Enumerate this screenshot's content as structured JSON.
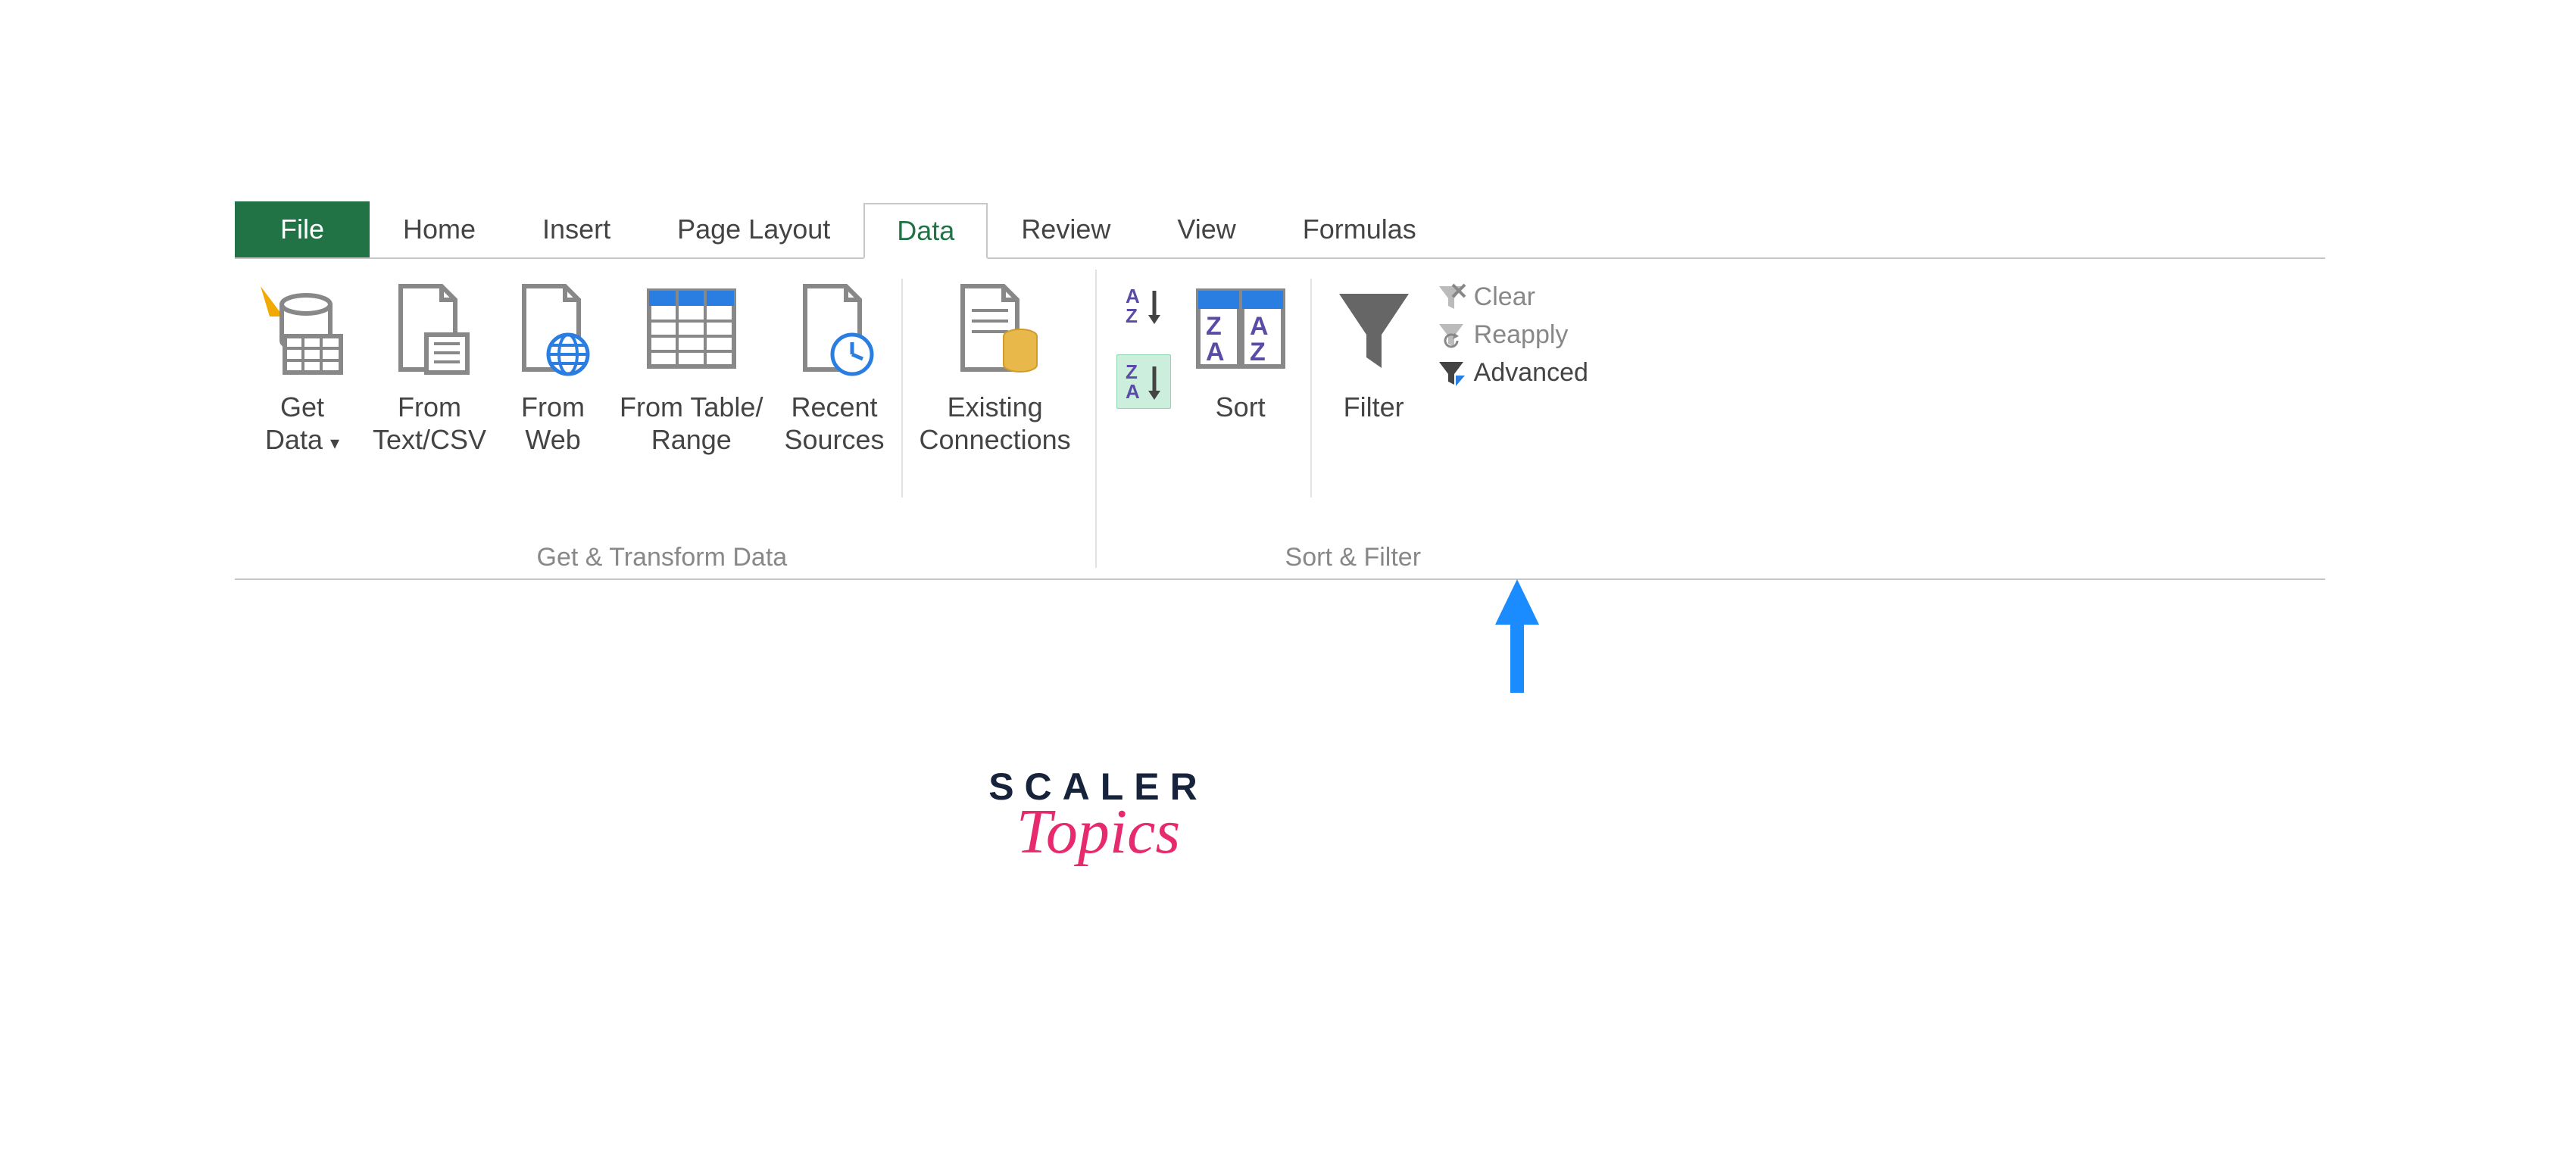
{
  "tabs": {
    "file": "File",
    "home": "Home",
    "insert": "Insert",
    "page_layout": "Page Layout",
    "data": "Data",
    "review": "Review",
    "view": "View",
    "formulas": "Formulas"
  },
  "ribbon": {
    "group_get_transform": {
      "label": "Get & Transform Data",
      "get_data": "Get\nData",
      "from_text_csv": "From\nText/CSV",
      "from_web": "From\nWeb",
      "from_table_range": "From Table/\nRange",
      "recent_sources": "Recent\nSources",
      "existing_connections": "Existing\nConnections"
    },
    "group_sort_filter": {
      "label": "Sort & Filter",
      "sort": "Sort",
      "filter": "Filter",
      "clear": "Clear",
      "reapply": "Reapply",
      "advanced": "Advanced"
    }
  },
  "logo": {
    "scaler": "SCALER",
    "topics": "Topics"
  }
}
